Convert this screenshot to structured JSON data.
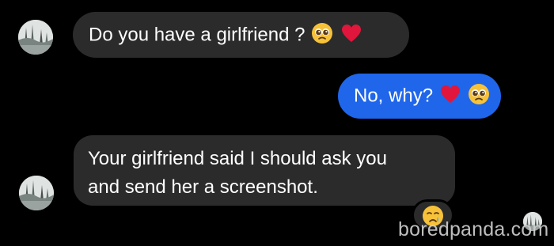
{
  "conversation": {
    "messages": [
      {
        "direction": "incoming",
        "text": "Do you have a girlfriend ?",
        "emojis": [
          "pleading-face-emoji",
          "red-heart-emoji"
        ]
      },
      {
        "direction": "outgoing",
        "text": "No, why?",
        "emojis": [
          "red-heart-emoji",
          "pleading-face-emoji"
        ]
      },
      {
        "direction": "incoming",
        "text_lines": [
          "Your girlfriend said I should ask you",
          "and send her a screenshot."
        ],
        "reaction": "crying-face-emoji"
      }
    ]
  },
  "watermark": {
    "text": "boredpanda.com"
  },
  "colors": {
    "background": "#000000",
    "incoming_bubble": "#2b2b2b",
    "outgoing_bubble": "#1f66ea",
    "text": "#ffffff",
    "heart": "#e0163c",
    "emoji_face": "#f7c23a"
  },
  "icons": {
    "avatar": "avatar-icon",
    "heart": "red-heart-emoji",
    "pleading": "pleading-face-emoji",
    "crying": "crying-face-emoji"
  }
}
